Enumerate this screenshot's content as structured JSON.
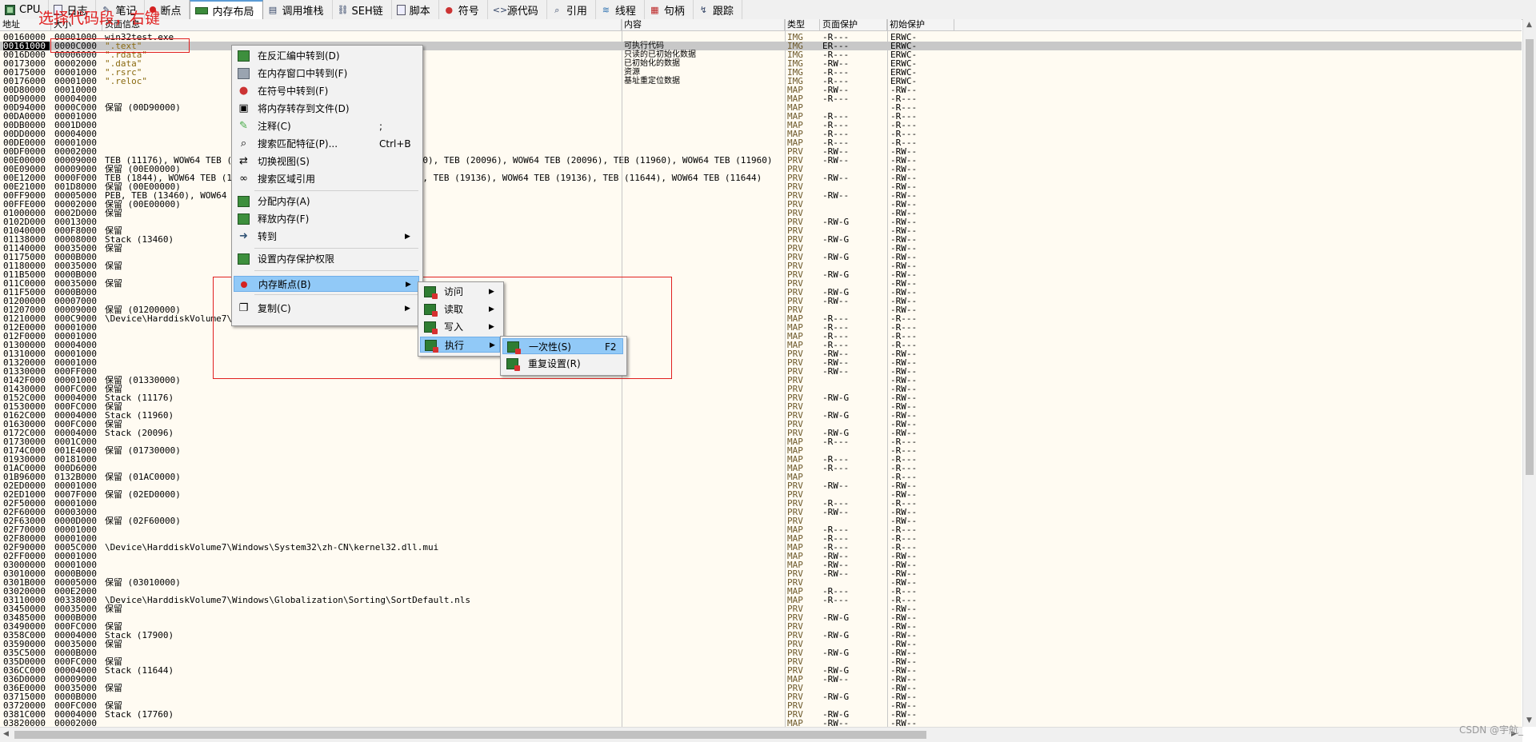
{
  "tabs": [
    {
      "label": "CPU",
      "icon": "cpu-icon"
    },
    {
      "label": "日志",
      "icon": "log-icon"
    },
    {
      "label": "笔记",
      "icon": "notes-icon"
    },
    {
      "label": "断点",
      "icon": "breakpoint-dot-icon"
    },
    {
      "label": "内存布局",
      "icon": "memory-map-icon",
      "active": true
    },
    {
      "label": "调用堆栈",
      "icon": "call-stack-icon"
    },
    {
      "label": "SEH链",
      "icon": "seh-chain-icon"
    },
    {
      "label": "脚本",
      "icon": "script-icon"
    },
    {
      "label": "符号",
      "icon": "symbols-icon"
    },
    {
      "label": "源代码",
      "icon": "source-code-icon"
    },
    {
      "label": "引用",
      "icon": "references-icon"
    },
    {
      "label": "线程",
      "icon": "threads-icon"
    },
    {
      "label": "句柄",
      "icon": "handles-icon"
    },
    {
      "label": "跟踪",
      "icon": "trace-icon"
    }
  ],
  "columns": {
    "address": "地址",
    "size": "大小",
    "info": "页面信息",
    "content": "内容",
    "type": "类型",
    "protection": "页面保护",
    "initial": "初始保护"
  },
  "annotation": {
    "text": "选择代码段，右键",
    "color": "#e02020"
  },
  "rows": [
    {
      "addr": "00160000",
      "size": "00001000",
      "info": "win32test.exe",
      "content": "",
      "type": "IMG",
      "prot": "-R---",
      "init": "ERWC-"
    },
    {
      "addr": "00161000",
      "size": "0000C000",
      "info": "\".text\"",
      "content": "可执行代码",
      "type": "IMG",
      "prot": "ER---",
      "init": "ERWC-",
      "selected": true,
      "str": true
    },
    {
      "addr": "0016D000",
      "size": "00006000",
      "info": "\".rdata\"",
      "content": "只读的已初始化数据",
      "type": "IMG",
      "prot": "-R---",
      "init": "ERWC-",
      "str": true
    },
    {
      "addr": "00173000",
      "size": "00002000",
      "info": "\".data\"",
      "content": "已初始化的数据",
      "type": "IMG",
      "prot": "-RW--",
      "init": "ERWC-",
      "str": true
    },
    {
      "addr": "00175000",
      "size": "00001000",
      "info": "\".rsrc\"",
      "content": "资源",
      "type": "IMG",
      "prot": "-R---",
      "init": "ERWC-",
      "str": true
    },
    {
      "addr": "00176000",
      "size": "00001000",
      "info": "\".reloc\"",
      "content": "基址重定位数据",
      "type": "IMG",
      "prot": "-R---",
      "init": "ERWC-",
      "str": true
    },
    {
      "addr": "00D80000",
      "size": "00010000",
      "info": "",
      "content": "",
      "type": "MAP",
      "prot": "-RW--",
      "init": "-RW--"
    },
    {
      "addr": "00D90000",
      "size": "00004000",
      "info": "",
      "content": "",
      "type": "MAP",
      "prot": "-R---",
      "init": "-R---"
    },
    {
      "addr": "00D94000",
      "size": "0000C000",
      "info": "保留 (00D90000)",
      "content": "",
      "type": "MAP",
      "prot": "",
      "init": "-R---"
    },
    {
      "addr": "00DA0000",
      "size": "00001000",
      "info": "",
      "content": "",
      "type": "MAP",
      "prot": "-R---",
      "init": "-R---"
    },
    {
      "addr": "00DB0000",
      "size": "0001D000",
      "info": "",
      "content": "",
      "type": "MAP",
      "prot": "-R---",
      "init": "-R---"
    },
    {
      "addr": "00DD0000",
      "size": "00004000",
      "info": "",
      "content": "",
      "type": "MAP",
      "prot": "-R---",
      "init": "-R---"
    },
    {
      "addr": "00DE0000",
      "size": "00001000",
      "info": "",
      "content": "",
      "type": "MAP",
      "prot": "-R---",
      "init": "-R---"
    },
    {
      "addr": "00DF0000",
      "size": "00002000",
      "info": "",
      "content": "",
      "type": "PRV",
      "prot": "-RW--",
      "init": "-RW--"
    },
    {
      "addr": "00E00000",
      "size": "00009000",
      "info": "TEB (11176), WOW64 TEB (11176), TEB (13460), WOW64 TEB (13460), TEB (20096), WOW64 TEB (20096), TEB (11960), WOW64 TEB (11960)",
      "content": "",
      "type": "PRV",
      "prot": "-RW--",
      "init": "-RW--"
    },
    {
      "addr": "00E09000",
      "size": "00009000",
      "info": "保留 (00E00000)",
      "content": "",
      "type": "PRV",
      "prot": "",
      "init": "-RW--"
    },
    {
      "addr": "00E12000",
      "size": "0000F000",
      "info": "TEB (1844), WOW64 TEB (1844), TEB (17900), WOW64 TEB (17900), TEB (19136), WOW64 TEB (19136), TEB (11644), WOW64 TEB (11644)",
      "content": "",
      "type": "PRV",
      "prot": "-RW--",
      "init": "-RW--"
    },
    {
      "addr": "00E21000",
      "size": "001D8000",
      "info": "保留 (00E00000)",
      "content": "",
      "type": "PRV",
      "prot": "",
      "init": "-RW--"
    },
    {
      "addr": "00FF9000",
      "size": "00005000",
      "info": "PEB, TEB (13460), WOW64 TEB (13460)",
      "content": "",
      "type": "PRV",
      "prot": "-RW--",
      "init": "-RW--"
    },
    {
      "addr": "00FFE000",
      "size": "00002000",
      "info": "保留 (00E00000)",
      "content": "",
      "type": "PRV",
      "prot": "",
      "init": "-RW--"
    },
    {
      "addr": "01000000",
      "size": "0002D000",
      "info": "保留",
      "content": "",
      "type": "PRV",
      "prot": "",
      "init": "-RW--"
    },
    {
      "addr": "0102D000",
      "size": "00013000",
      "info": "",
      "content": "",
      "type": "PRV",
      "prot": "-RW-G",
      "init": "-RW--"
    },
    {
      "addr": "01040000",
      "size": "000F8000",
      "info": "保留",
      "content": "",
      "type": "PRV",
      "prot": "",
      "init": "-RW--"
    },
    {
      "addr": "01138000",
      "size": "00008000",
      "info": "Stack (13460)",
      "content": "",
      "type": "PRV",
      "prot": "-RW-G",
      "init": "-RW--"
    },
    {
      "addr": "01140000",
      "size": "00035000",
      "info": "保留",
      "content": "",
      "type": "PRV",
      "prot": "",
      "init": "-RW--"
    },
    {
      "addr": "01175000",
      "size": "0000B000",
      "info": "",
      "content": "",
      "type": "PRV",
      "prot": "-RW-G",
      "init": "-RW--"
    },
    {
      "addr": "01180000",
      "size": "00035000",
      "info": "保留",
      "content": "",
      "type": "PRV",
      "prot": "",
      "init": "-RW--"
    },
    {
      "addr": "011B5000",
      "size": "0000B000",
      "info": "",
      "content": "",
      "type": "PRV",
      "prot": "-RW-G",
      "init": "-RW--"
    },
    {
      "addr": "011C0000",
      "size": "00035000",
      "info": "保留",
      "content": "",
      "type": "PRV",
      "prot": "",
      "init": "-RW--"
    },
    {
      "addr": "011F5000",
      "size": "0000B000",
      "info": "",
      "content": "",
      "type": "PRV",
      "prot": "-RW-G",
      "init": "-RW--"
    },
    {
      "addr": "01200000",
      "size": "00007000",
      "info": "",
      "content": "",
      "type": "PRV",
      "prot": "-RW--",
      "init": "-RW--"
    },
    {
      "addr": "01207000",
      "size": "00009000",
      "info": "保留 (01200000)",
      "content": "",
      "type": "PRV",
      "prot": "",
      "init": "-RW--"
    },
    {
      "addr": "01210000",
      "size": "000C9000",
      "info": "\\Device\\HarddiskVolume7\\Windows\\System32\\locale.nls",
      "content": "",
      "type": "MAP",
      "prot": "-R---",
      "init": "-R---"
    },
    {
      "addr": "012E0000",
      "size": "00001000",
      "info": "",
      "content": "",
      "type": "MAP",
      "prot": "-R---",
      "init": "-R---"
    },
    {
      "addr": "012F0000",
      "size": "00001000",
      "info": "",
      "content": "",
      "type": "MAP",
      "prot": "-R---",
      "init": "-R---"
    },
    {
      "addr": "01300000",
      "size": "00004000",
      "info": "",
      "content": "",
      "type": "MAP",
      "prot": "-R---",
      "init": "-R---"
    },
    {
      "addr": "01310000",
      "size": "00001000",
      "info": "",
      "content": "",
      "type": "PRV",
      "prot": "-RW--",
      "init": "-RW--"
    },
    {
      "addr": "01320000",
      "size": "00001000",
      "info": "",
      "content": "",
      "type": "PRV",
      "prot": "-RW--",
      "init": "-RW--"
    },
    {
      "addr": "01330000",
      "size": "000FF000",
      "info": "",
      "content": "",
      "type": "PRV",
      "prot": "-RW--",
      "init": "-RW--"
    },
    {
      "addr": "0142F000",
      "size": "00001000",
      "info": "保留 (01330000)",
      "content": "",
      "type": "PRV",
      "prot": "",
      "init": "-RW--"
    },
    {
      "addr": "01430000",
      "size": "000FC000",
      "info": "保留",
      "content": "",
      "type": "PRV",
      "prot": "",
      "init": "-RW--"
    },
    {
      "addr": "0152C000",
      "size": "00004000",
      "info": "Stack (11176)",
      "content": "",
      "type": "PRV",
      "prot": "-RW-G",
      "init": "-RW--"
    },
    {
      "addr": "01530000",
      "size": "000FC000",
      "info": "保留",
      "content": "",
      "type": "PRV",
      "prot": "",
      "init": "-RW--"
    },
    {
      "addr": "0162C000",
      "size": "00004000",
      "info": "Stack (11960)",
      "content": "",
      "type": "PRV",
      "prot": "-RW-G",
      "init": "-RW--"
    },
    {
      "addr": "01630000",
      "size": "000FC000",
      "info": "保留",
      "content": "",
      "type": "PRV",
      "prot": "",
      "init": "-RW--"
    },
    {
      "addr": "0172C000",
      "size": "00004000",
      "info": "Stack (20096)",
      "content": "",
      "type": "PRV",
      "prot": "-RW-G",
      "init": "-RW--"
    },
    {
      "addr": "01730000",
      "size": "0001C000",
      "info": "",
      "content": "",
      "type": "MAP",
      "prot": "-R---",
      "init": "-R---"
    },
    {
      "addr": "0174C000",
      "size": "001E4000",
      "info": "保留 (01730000)",
      "content": "",
      "type": "MAP",
      "prot": "",
      "init": "-R---"
    },
    {
      "addr": "01930000",
      "size": "00181000",
      "info": "",
      "content": "",
      "type": "MAP",
      "prot": "-R---",
      "init": "-R---"
    },
    {
      "addr": "01AC0000",
      "size": "000D6000",
      "info": "",
      "content": "",
      "type": "MAP",
      "prot": "-R---",
      "init": "-R---"
    },
    {
      "addr": "01B96000",
      "size": "0132B000",
      "info": "保留 (01AC0000)",
      "content": "",
      "type": "MAP",
      "prot": "",
      "init": "-R---"
    },
    {
      "addr": "02ED0000",
      "size": "00001000",
      "info": "",
      "content": "",
      "type": "PRV",
      "prot": "-RW--",
      "init": "-RW--"
    },
    {
      "addr": "02ED1000",
      "size": "0007F000",
      "info": "保留 (02ED0000)",
      "content": "",
      "type": "PRV",
      "prot": "",
      "init": "-RW--"
    },
    {
      "addr": "02F50000",
      "size": "00001000",
      "info": "",
      "content": "",
      "type": "PRV",
      "prot": "-R---",
      "init": "-R---"
    },
    {
      "addr": "02F60000",
      "size": "00003000",
      "info": "",
      "content": "",
      "type": "PRV",
      "prot": "-RW--",
      "init": "-RW--"
    },
    {
      "addr": "02F63000",
      "size": "0000D000",
      "info": "保留 (02F60000)",
      "content": "",
      "type": "PRV",
      "prot": "",
      "init": "-RW--"
    },
    {
      "addr": "02F70000",
      "size": "00001000",
      "info": "",
      "content": "",
      "type": "MAP",
      "prot": "-R---",
      "init": "-R---"
    },
    {
      "addr": "02F80000",
      "size": "00001000",
      "info": "",
      "content": "",
      "type": "MAP",
      "prot": "-R---",
      "init": "-R---"
    },
    {
      "addr": "02F90000",
      "size": "0005C000",
      "info": "\\Device\\HarddiskVolume7\\Windows\\System32\\zh-CN\\kernel32.dll.mui",
      "content": "",
      "type": "MAP",
      "prot": "-R---",
      "init": "-R---"
    },
    {
      "addr": "02FF0000",
      "size": "00001000",
      "info": "",
      "content": "",
      "type": "MAP",
      "prot": "-RW--",
      "init": "-RW--"
    },
    {
      "addr": "03000000",
      "size": "00001000",
      "info": "",
      "content": "",
      "type": "MAP",
      "prot": "-RW--",
      "init": "-RW--"
    },
    {
      "addr": "03010000",
      "size": "0000B000",
      "info": "",
      "content": "",
      "type": "PRV",
      "prot": "-RW--",
      "init": "-RW--"
    },
    {
      "addr": "0301B000",
      "size": "00005000",
      "info": "保留 (03010000)",
      "content": "",
      "type": "PRV",
      "prot": "",
      "init": "-RW--"
    },
    {
      "addr": "03020000",
      "size": "000E2000",
      "info": "",
      "content": "",
      "type": "MAP",
      "prot": "-R---",
      "init": "-R---"
    },
    {
      "addr": "03110000",
      "size": "00338000",
      "info": "\\Device\\HarddiskVolume7\\Windows\\Globalization\\Sorting\\SortDefault.nls",
      "content": "",
      "type": "MAP",
      "prot": "-R---",
      "init": "-R---"
    },
    {
      "addr": "03450000",
      "size": "00035000",
      "info": "保留",
      "content": "",
      "type": "PRV",
      "prot": "",
      "init": "-RW--"
    },
    {
      "addr": "03485000",
      "size": "0000B000",
      "info": "",
      "content": "",
      "type": "PRV",
      "prot": "-RW-G",
      "init": "-RW--"
    },
    {
      "addr": "03490000",
      "size": "000FC000",
      "info": "保留",
      "content": "",
      "type": "PRV",
      "prot": "",
      "init": "-RW--"
    },
    {
      "addr": "0358C000",
      "size": "00004000",
      "info": "Stack (17900)",
      "content": "",
      "type": "PRV",
      "prot": "-RW-G",
      "init": "-RW--"
    },
    {
      "addr": "03590000",
      "size": "00035000",
      "info": "保留",
      "content": "",
      "type": "PRV",
      "prot": "",
      "init": "-RW--"
    },
    {
      "addr": "035C5000",
      "size": "0000B000",
      "info": "",
      "content": "",
      "type": "PRV",
      "prot": "-RW-G",
      "init": "-RW--"
    },
    {
      "addr": "035D0000",
      "size": "000FC000",
      "info": "保留",
      "content": "",
      "type": "PRV",
      "prot": "",
      "init": "-RW--"
    },
    {
      "addr": "036CC000",
      "size": "00004000",
      "info": "Stack (11644)",
      "content": "",
      "type": "PRV",
      "prot": "-RW-G",
      "init": "-RW--"
    },
    {
      "addr": "036D0000",
      "size": "00009000",
      "info": "",
      "content": "",
      "type": "MAP",
      "prot": "-RW--",
      "init": "-RW--"
    },
    {
      "addr": "036E0000",
      "size": "00035000",
      "info": "保留",
      "content": "",
      "type": "PRV",
      "prot": "",
      "init": "-RW--"
    },
    {
      "addr": "03715000",
      "size": "0000B000",
      "info": "",
      "content": "",
      "type": "PRV",
      "prot": "-RW-G",
      "init": "-RW--"
    },
    {
      "addr": "03720000",
      "size": "000FC000",
      "info": "保留",
      "content": "",
      "type": "PRV",
      "prot": "",
      "init": "-RW--"
    },
    {
      "addr": "0381C000",
      "size": "00004000",
      "info": "Stack (17760)",
      "content": "",
      "type": "PRV",
      "prot": "-RW-G",
      "init": "-RW--"
    },
    {
      "addr": "03820000",
      "size": "00002000",
      "info": "",
      "content": "",
      "type": "MAP",
      "prot": "-RW--",
      "init": "-RW--"
    }
  ],
  "context_menu": {
    "items": [
      {
        "label": "在反汇编中转到(D)",
        "shortcut": "",
        "icon": "disassembly-icon"
      },
      {
        "label": "在内存窗口中转到(F)",
        "shortcut": "",
        "icon": "dump-icon"
      },
      {
        "label": "在符号中转到(F)",
        "shortcut": "",
        "icon": "symbol-icon"
      },
      {
        "label": "将内存转存到文件(D)",
        "shortcut": "",
        "icon": "save-disk-icon"
      },
      {
        "label": "注释(C)",
        "shortcut": ";",
        "icon": "comment-icon"
      },
      {
        "label": "搜索匹配特征(P)...",
        "shortcut": "Ctrl+B",
        "icon": "search-pattern-icon"
      },
      {
        "label": "切换视图(S)",
        "shortcut": "",
        "icon": "toggle-view-icon"
      },
      {
        "label": "搜索区域引用",
        "shortcut": "",
        "icon": "binoculars-icon"
      },
      {
        "label": "分配内存(A)",
        "shortcut": "",
        "icon": "allocate-memory-icon"
      },
      {
        "label": "释放内存(F)",
        "shortcut": "",
        "icon": "free-memory-icon"
      },
      {
        "label": "转到",
        "shortcut": "",
        "icon": "goto-icon"
      },
      {
        "label": "设置内存保护权限",
        "shortcut": "",
        "icon": "set-protection-icon"
      },
      {
        "label": "内存断点(B)",
        "shortcut": "",
        "icon": "memory-breakpoint-icon"
      },
      {
        "label": "复制(C)",
        "shortcut": "",
        "icon": "copy-icon"
      }
    ]
  },
  "submenu_breakpoint": {
    "items": [
      {
        "label": "访问",
        "icon": "bp-access-icon"
      },
      {
        "label": "读取",
        "icon": "bp-read-icon"
      },
      {
        "label": "写入",
        "icon": "bp-write-icon"
      },
      {
        "label": "执行",
        "icon": "bp-execute-icon"
      }
    ]
  },
  "submenu_execute": {
    "items": [
      {
        "label": "一次性(S)",
        "shortcut": "F2",
        "icon": "bp-once-icon"
      },
      {
        "label": "重复设置(R)",
        "shortcut": "",
        "icon": "bp-restore-icon"
      }
    ]
  },
  "watermark": "CSDN @宇航_"
}
